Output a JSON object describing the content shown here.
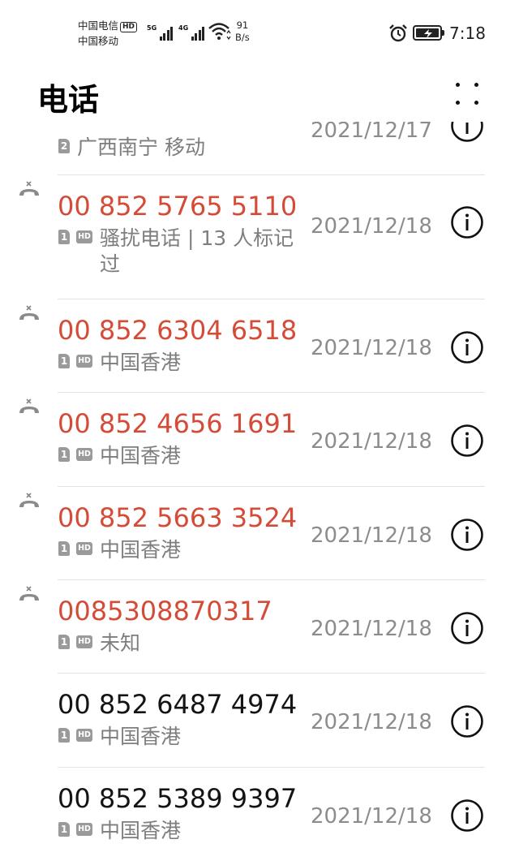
{
  "status_bar": {
    "carrier1": "中国电信",
    "carrier1_badge": "HD",
    "carrier2": "中国移动",
    "net1": "5G",
    "net2": "4G",
    "speed_value": "91",
    "speed_unit": "B/s",
    "time": "7:18"
  },
  "header": {
    "title": "电话"
  },
  "calls": [
    {
      "number": "",
      "missed": false,
      "sim": "2",
      "hd": false,
      "location": "广西南宁 移动",
      "date": "2021/12/17"
    },
    {
      "number": "00 852 5765 5110",
      "missed": true,
      "sim": "1",
      "hd": true,
      "location": "骚扰电话 | 13 人标记过",
      "date": "2021/12/18"
    },
    {
      "number": "00 852 6304 6518",
      "missed": true,
      "sim": "1",
      "hd": true,
      "location": "中国香港",
      "date": "2021/12/18"
    },
    {
      "number": "00 852 4656 1691",
      "missed": true,
      "sim": "1",
      "hd": true,
      "location": "中国香港",
      "date": "2021/12/18"
    },
    {
      "number": "00 852 5663 3524",
      "missed": true,
      "sim": "1",
      "hd": true,
      "location": "中国香港",
      "date": "2021/12/18"
    },
    {
      "number": "0085308870317",
      "missed": true,
      "sim": "1",
      "hd": true,
      "location": "未知",
      "date": "2021/12/18"
    },
    {
      "number": "00 852 6487 4974",
      "missed": false,
      "sim": "1",
      "hd": true,
      "location": "中国香港",
      "date": "2021/12/18"
    },
    {
      "number": "00 852 5389 9397",
      "missed": false,
      "sim": "1",
      "hd": true,
      "location": "中国香港",
      "date": "2021/12/18"
    }
  ],
  "hd_badge": "HD",
  "colors": {
    "missed": "#d44b38",
    "normal": "#141414",
    "secondary": "#7e7e7e"
  }
}
